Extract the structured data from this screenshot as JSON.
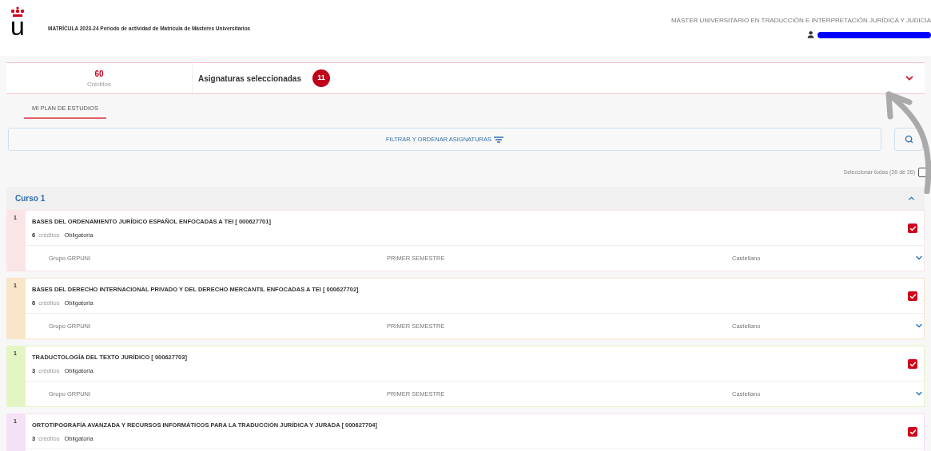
{
  "header": {
    "logo_letter": "u",
    "title": "MATRÍCULA 2023-24 Periodo de actividad de Matrícula de Másteres Universitarios",
    "program": "MÁSTER UNIVERSITARIO EN TRADUCCIÓN E INTERPRETACIÓN JURÍDICA Y JUDICIA"
  },
  "summary": {
    "credits": "60",
    "credits_label": "Créditos",
    "selected_label": "Asignaturas seleccionadas",
    "selected_count": "11",
    "expanded": false
  },
  "tabs": [
    {
      "label": "MI PLAN DE ESTUDIOS",
      "selected": true
    }
  ],
  "filter": {
    "label": "FILTRAR Y ORDENAR ASIGNATURAS"
  },
  "select_all": {
    "label": "Seleccionar todas (26 de 26)",
    "checked": false
  },
  "course": {
    "title": "Curso 1",
    "expanded": true,
    "subjects": [
      {
        "number": "1",
        "name": "BASES DEL ORDENAMIENTO JURÍDICO ESPAÑOL ENFOCADAS A TEI [ 000627701]",
        "credits": "6",
        "credits_label": "créditos",
        "type": "Obligatoria",
        "group": "Grupo GRPUNI",
        "semester": "PRIMER SEMESTRE",
        "language": "Castellano",
        "checked": true,
        "color": "#fbe4e6"
      },
      {
        "number": "1",
        "name": "BASES DEL DERECHO INTERNACIONAL PRIVADO Y DEL DERECHO MERCANTIL ENFOCADAS A TEI [ 000627702]",
        "credits": "6",
        "credits_label": "créditos",
        "type": "Obligatoria",
        "group": "Grupo GRPUNI",
        "semester": "PRIMER SEMESTRE",
        "language": "Castellano",
        "checked": true,
        "color": "#f9e5c9"
      },
      {
        "number": "1",
        "name": "TRADUCTOLOGÍA DEL TEXTO JURÍDICO [ 000627703]",
        "credits": "3",
        "credits_label": "créditos",
        "type": "Obligatoria",
        "group": "Grupo GRPUNI",
        "semester": "PRIMER SEMESTRE",
        "language": "Castellano",
        "checked": true,
        "color": "#e4f5c4"
      },
      {
        "number": "1",
        "name": "ORTOTIPOGRAFÍA AVANZADA Y RECURSOS INFORMÁTICOS PARA LA TRADUCCIÓN JURÍDICA Y JURADA [ 000627704]",
        "credits": "3",
        "credits_label": "créditos",
        "type": "Obligatoria",
        "checked": true,
        "color": "#f5e1f5"
      }
    ]
  }
}
